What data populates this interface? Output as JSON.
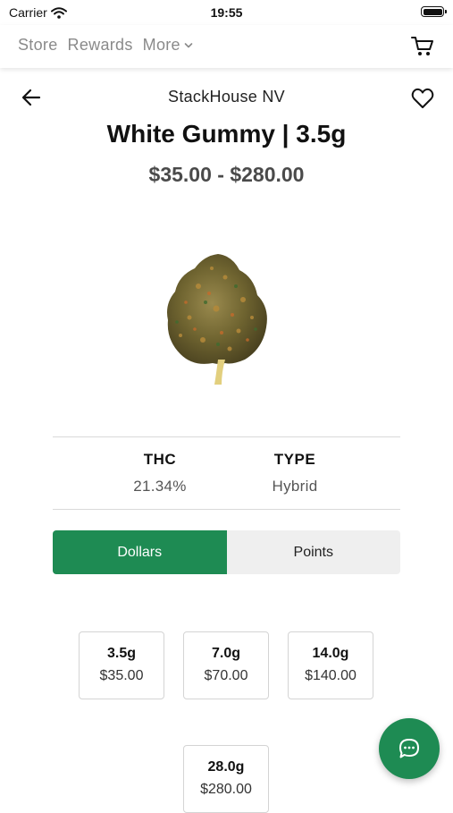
{
  "status_bar": {
    "carrier": "Carrier",
    "time": "19:55"
  },
  "nav": {
    "links": [
      "Store",
      "Rewards",
      "More"
    ],
    "icons": {
      "more": "chevron-down-icon",
      "cart": "cart-icon"
    }
  },
  "header": {
    "store_name": "StackHouse NV",
    "icons": {
      "back": "back-arrow-icon",
      "favorite": "heart-icon"
    }
  },
  "product": {
    "title": "White Gummy | 3.5g",
    "price_range": "$35.00 - $280.00",
    "image": "cannabis-flower-bud"
  },
  "stats": {
    "thc_label": "THC",
    "thc_value": "21.34%",
    "type_label": "TYPE",
    "type_value": "Hybrid"
  },
  "currency_toggle": {
    "options": [
      "Dollars",
      "Points"
    ],
    "selected": "Dollars",
    "accent_color": "#1e8b53"
  },
  "sizes": [
    {
      "weight": "3.5g",
      "price": "$35.00"
    },
    {
      "weight": "7.0g",
      "price": "$70.00"
    },
    {
      "weight": "14.0g",
      "price": "$140.00"
    },
    {
      "weight": "28.0g",
      "price": "$280.00"
    }
  ],
  "chat": {
    "icon": "chat-bubble-icon"
  }
}
